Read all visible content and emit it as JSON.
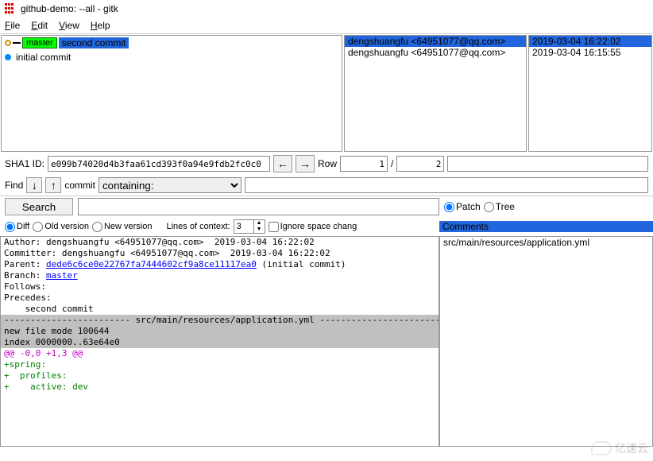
{
  "window": {
    "title": "github-demo: --all - gitk"
  },
  "menu": {
    "file": "File",
    "edit": "Edit",
    "view": "View",
    "help": "Help"
  },
  "commits": {
    "rows": [
      {
        "branch": "master",
        "msg": "second commit",
        "author": "dengshuangfu <64951077@qq.com>",
        "date": "2019-03-04 16:22:02",
        "selected": true,
        "head": true
      },
      {
        "msg": "initial commit",
        "author": "dengshuangfu <64951077@qq.com>",
        "date": "2019-03-04 16:15:55",
        "selected": false,
        "head": false
      }
    ]
  },
  "sha": {
    "label": "SHA1 ID:",
    "value": "e099b74020d4b3faa61cd393f0a94e9fdb2fc0c0",
    "row_label": "Row",
    "row_current": "1",
    "row_sep": "/",
    "row_total": "2"
  },
  "find": {
    "label": "Find",
    "mode": "commit",
    "criteria": "containing:"
  },
  "search": {
    "button": "Search"
  },
  "patch_tree": {
    "patch": "Patch",
    "tree": "Tree"
  },
  "view_opts": {
    "diff": "Diff",
    "old": "Old version",
    "new": "New version",
    "lines_label": "Lines of context:",
    "lines_value": "3",
    "ignore": "Ignore space chang"
  },
  "files": {
    "header": "Comments",
    "items": [
      "src/main/resources/application.yml"
    ]
  },
  "diff": {
    "author": "Author: dengshuangfu <64951077@qq.com>  2019-03-04 16:22:02",
    "committer": "Committer: dengshuangfu <64951077@qq.com>  2019-03-04 16:22:02",
    "parent_label": "Parent: ",
    "parent_hash": "dede6c6ce0e22767fa7444602cf9a8ce11117ea0",
    "parent_msg": " (initial commit)",
    "branch_label": "Branch: ",
    "branch_name": "master",
    "follows": "Follows:",
    "precedes": "Precedes:",
    "blank": "",
    "message": "    second commit",
    "file_sep": "------------------------ src/main/resources/application.yml ------------------------",
    "mode": "new file mode 100644",
    "index": "index 0000000..63e64e0",
    "hunk": "@@ -0,0 +1,3 @@",
    "add1": "+spring:",
    "add2": "+  profiles:",
    "add3": "+    active: dev"
  },
  "watermark": "亿速云"
}
